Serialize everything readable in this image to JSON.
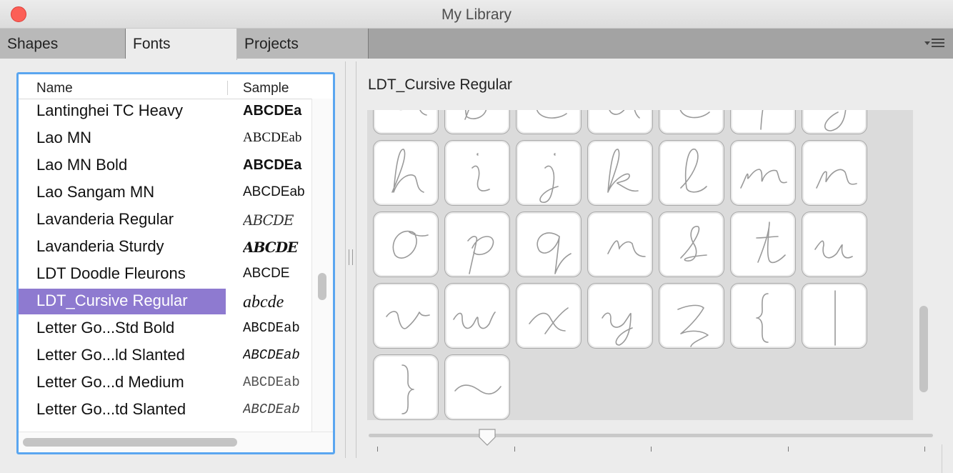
{
  "window": {
    "title": "My Library"
  },
  "tabs": [
    {
      "label": "Shapes",
      "active": false
    },
    {
      "label": "Fonts",
      "active": true
    },
    {
      "label": "Projects",
      "active": false
    }
  ],
  "list": {
    "columns": {
      "name": "Name",
      "sample": "Sample"
    },
    "rows": [
      {
        "name": "Lantinghei TC Heavy",
        "sample": "ABCDEa",
        "style": "bold"
      },
      {
        "name": "Lao MN",
        "sample": "ABCDEab",
        "style": "serif"
      },
      {
        "name": "Lao MN Bold",
        "sample": "ABCDEa",
        "style": "bold"
      },
      {
        "name": "Lao Sangam MN",
        "sample": "ABCDEab",
        "style": "normal"
      },
      {
        "name": "Lavanderia Regular",
        "sample": "ABCDE",
        "style": "script"
      },
      {
        "name": "Lavanderia Sturdy",
        "sample": "ABCDE",
        "style": "script-bold"
      },
      {
        "name": "LDT Doodle Fleurons",
        "sample": "ABCDE",
        "style": "doodle"
      },
      {
        "name": "LDT_Cursive Regular",
        "sample": "abcde",
        "style": "cursive",
        "selected": true
      },
      {
        "name": "Letter Go...Std Bold",
        "sample": "ABCDEab",
        "style": "mono"
      },
      {
        "name": "Letter Go...ld Slanted",
        "sample": "ABCDEab",
        "style": "mono-italic"
      },
      {
        "name": "Letter Go...d Medium",
        "sample": "ABCDEab",
        "style": "mono-light"
      },
      {
        "name": "Letter Go...td Slanted",
        "sample": "ABCDEab",
        "style": "mono-italic-light"
      }
    ],
    "vscroll": {
      "position": 0.57,
      "visible_fraction": 0.08
    },
    "hscroll": {
      "position": 0.0,
      "visible_fraction": 0.7
    }
  },
  "preview": {
    "font_name": "LDT_Cursive Regular",
    "glyphs": [
      "a",
      "b",
      "c",
      "d",
      "e",
      "f",
      "g",
      "h",
      "i",
      "j",
      "k",
      "l",
      "m",
      "n",
      "o",
      "p",
      "q",
      "r",
      "s",
      "t",
      "u",
      "v",
      "w",
      "x",
      "y",
      "z",
      "{",
      "|",
      "}",
      "~"
    ],
    "scroll": {
      "position": 0.55,
      "visible_fraction": 0.3
    },
    "size_slider": {
      "value": 0.21,
      "ticks": 5
    }
  },
  "colors": {
    "selection": "#8e7ad0",
    "focus_ring": "#5aa6f0",
    "close_button": "#fc5f57"
  },
  "icons": {
    "close": "close-dot-icon",
    "tab_menu": "list-menu-icon",
    "splitter": "splitter-grip-icon",
    "slider": "slider-knob-icon"
  }
}
